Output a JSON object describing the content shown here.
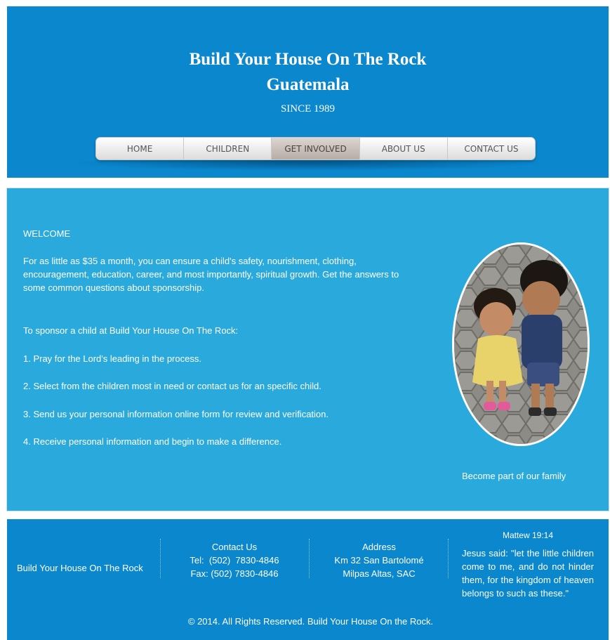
{
  "header": {
    "title_line1": "Build Your House On The Rock",
    "title_line2": "Guatemala",
    "since": "SINCE 1989",
    "background": "#0a87cd"
  },
  "nav": {
    "items": [
      {
        "label": "HOME",
        "active": false
      },
      {
        "label": "CHILDREN",
        "active": false
      },
      {
        "label": "GET INVOLVED",
        "active": true
      },
      {
        "label": "ABOUT US",
        "active": false
      },
      {
        "label": "CONTACT US",
        "active": false
      }
    ]
  },
  "main": {
    "background": "#2aaadc",
    "welcome_heading": "WELCOME",
    "welcome_body": "For as little as $35 a month, you can ensure a child's safety, nourishment, clothing, encouragement, education, career, and most importantly, spiritual growth. Get the answers to some common questions about sponsorship.",
    "sponsor_intro": "To sponsor a child at Build Your House On The Rock:",
    "steps": [
      "1. Pray for the Lord's leading in the process.",
      "2. Select from the children most in need or contact us for an specific child.",
      "3. Send us your personal information online form for review and verification.",
      "4. Receive personal information and begin to make a difference."
    ],
    "photo_caption": "Become part of our family"
  },
  "footer": {
    "org_name": "Build Your House On The Rock",
    "contact": {
      "heading": "Contact Us",
      "tel": "Tel:  (502)  7830-4846",
      "fax": "Fax: (502) 7830-4846"
    },
    "address": {
      "heading": "Address",
      "line1": "Km 32 San Bartolomé",
      "line2": "Milpas Altas, SAC"
    },
    "verse": {
      "reference": "Mattew 19:14",
      "text": "Jesus said: \"let the little children come to me, and do not hinder them, for the kingdom of heaven belongs to such as these.\""
    },
    "copyright": "© 2014. All Rights Reserved. Build Your House On the Rock."
  }
}
